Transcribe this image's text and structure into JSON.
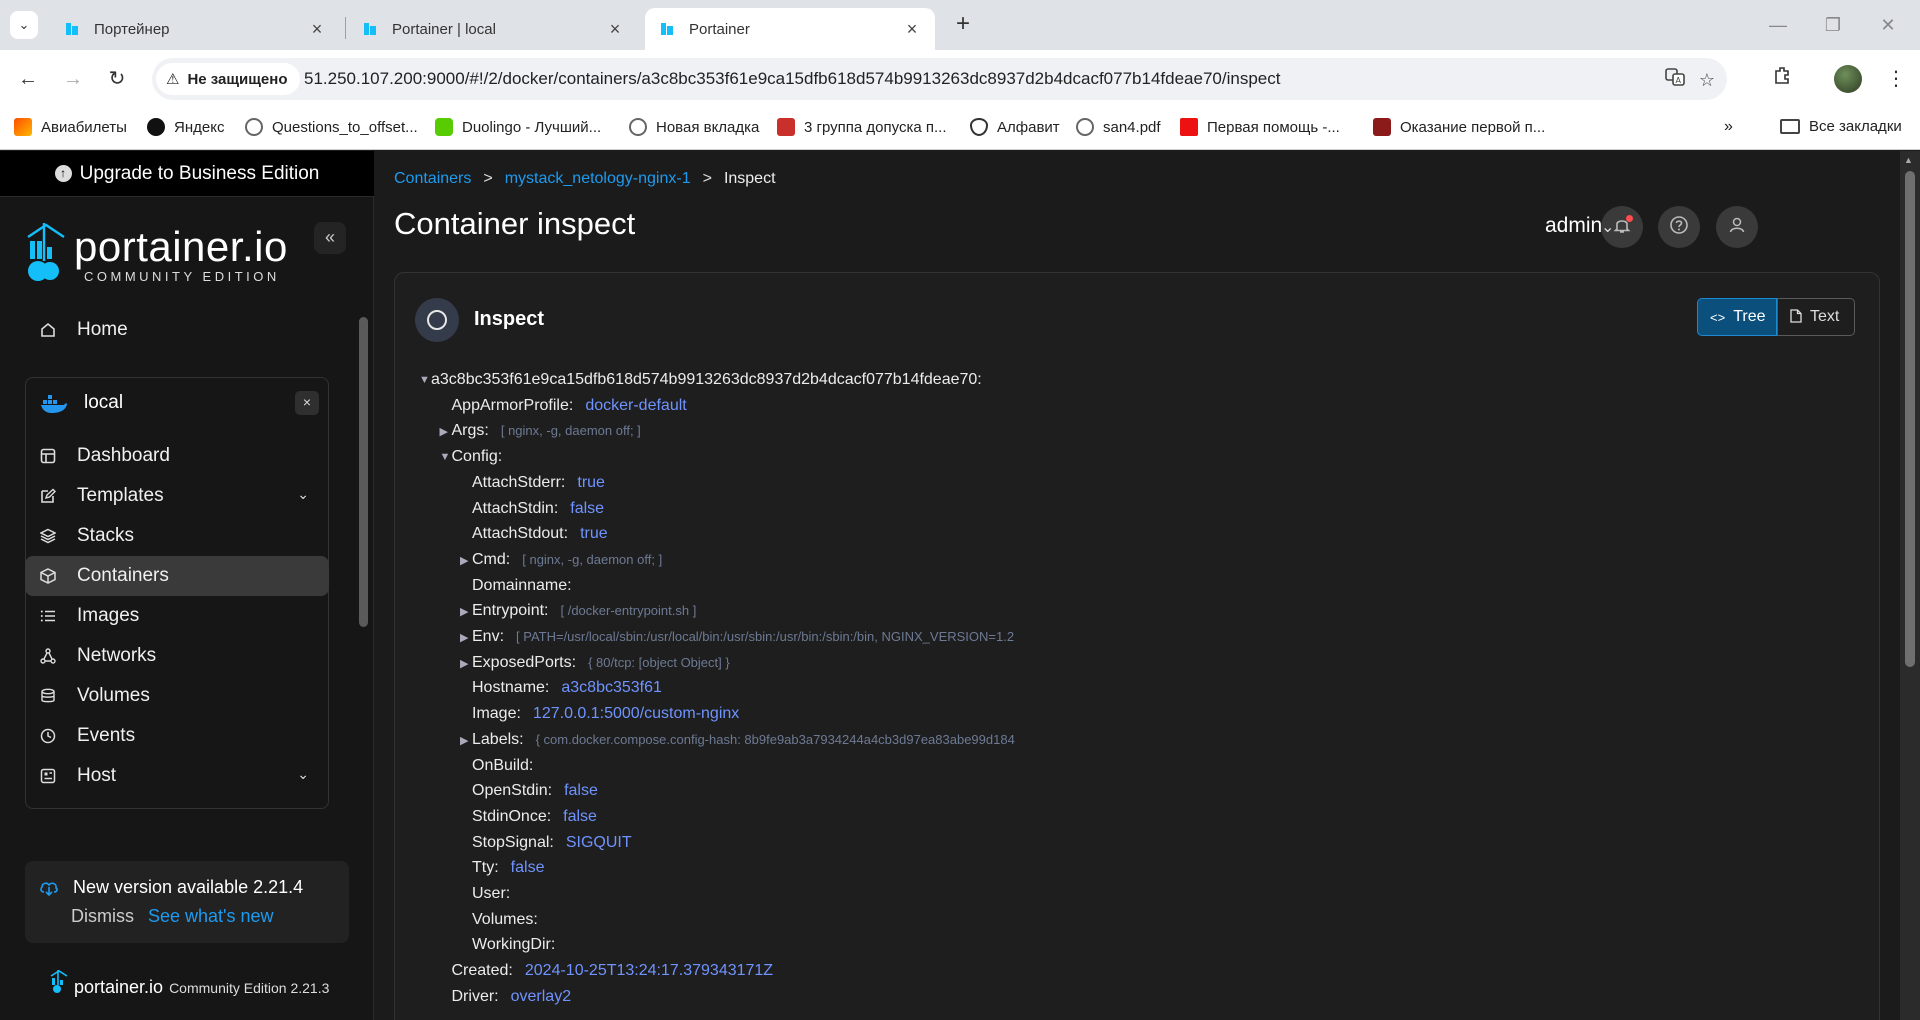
{
  "browser": {
    "tabs": [
      {
        "title": "Портейнер"
      },
      {
        "title": "Portainer | local"
      },
      {
        "title": "Portainer"
      }
    ],
    "security_label": "Не защищено",
    "url": "51.250.107.200:9000/#!/2/docker/containers/a3c8bc353f61e9ca15dfb618d574b9913263dc8937d2b4dcacf077b14fdeae70/inspect",
    "bookmarks": [
      "Авиабилеты",
      "Яндекс",
      "Questions_to_offset...",
      "Duolingo - Лучший...",
      "Новая вкладка",
      "3 группа допуска п...",
      "Алфавит",
      "san4.pdf",
      "Первая помощь -...",
      "Оказание первой п..."
    ],
    "all_bookmarks": "Все закладки"
  },
  "sidebar": {
    "upgrade": "Upgrade to Business Edition",
    "logo_word": "portainer.io",
    "logo_sub": "COMMUNITY EDITION",
    "home": "Home",
    "env_name": "local",
    "items": [
      "Dashboard",
      "Templates",
      "Stacks",
      "Containers",
      "Images",
      "Networks",
      "Volumes",
      "Events",
      "Host"
    ],
    "update_title": "New version available 2.21.4",
    "dismiss": "Dismiss",
    "whats_new": "See what's new",
    "footer_name": "portainer.io",
    "footer_version": "Community Edition 2.21.3"
  },
  "main": {
    "breadcrumb": [
      "Containers",
      "mystack_netology-nginx-1",
      "Inspect"
    ],
    "title": "Container inspect",
    "user": "admin",
    "widget_title": "Inspect",
    "view_tree": "Tree",
    "view_text": "Text"
  },
  "tree": [
    {
      "key": "a3c8bc353f61e9ca15dfb618d574b9913263dc8937d2b4dcacf077b14fdeae70:",
      "value": "",
      "preview": "",
      "depth": 0,
      "toggle": "open"
    },
    {
      "key": "AppArmorProfile:",
      "value": "docker-default",
      "preview": "",
      "depth": 1,
      "toggle": ""
    },
    {
      "key": "Args:",
      "value": "",
      "preview": "[ nginx, -g, daemon off; ]",
      "depth": 1,
      "toggle": "closed"
    },
    {
      "key": "Config:",
      "value": "",
      "preview": "",
      "depth": 1,
      "toggle": "open"
    },
    {
      "key": "AttachStderr:",
      "value": "true",
      "preview": "",
      "depth": 2,
      "toggle": ""
    },
    {
      "key": "AttachStdin:",
      "value": "false",
      "preview": "",
      "depth": 2,
      "toggle": ""
    },
    {
      "key": "AttachStdout:",
      "value": "true",
      "preview": "",
      "depth": 2,
      "toggle": ""
    },
    {
      "key": "Cmd:",
      "value": "",
      "preview": "[ nginx, -g, daemon off; ]",
      "depth": 2,
      "toggle": "closed"
    },
    {
      "key": "Domainname:",
      "value": "",
      "preview": "",
      "depth": 2,
      "toggle": ""
    },
    {
      "key": "Entrypoint:",
      "value": "",
      "preview": "[ /docker-entrypoint.sh ]",
      "depth": 2,
      "toggle": "closed"
    },
    {
      "key": "Env:",
      "value": "",
      "preview": "[ PATH=/usr/local/sbin:/usr/local/bin:/usr/sbin:/usr/bin:/sbin:/bin, NGINX_VERSION=1.2",
      "depth": 2,
      "toggle": "closed"
    },
    {
      "key": "ExposedPorts:",
      "value": "",
      "preview": "{ 80/tcp: [object Object] }",
      "depth": 2,
      "toggle": "closed"
    },
    {
      "key": "Hostname:",
      "value": "a3c8bc353f61",
      "preview": "",
      "depth": 2,
      "toggle": ""
    },
    {
      "key": "Image:",
      "value": "127.0.0.1:5000/custom-nginx",
      "preview": "",
      "depth": 2,
      "toggle": ""
    },
    {
      "key": "Labels:",
      "value": "",
      "preview": "{ com.docker.compose.config-hash: 8b9fe9ab3a7934244a4cb3d97ea83abe99d184",
      "depth": 2,
      "toggle": "closed"
    },
    {
      "key": "OnBuild:",
      "value": "",
      "preview": "",
      "depth": 2,
      "toggle": ""
    },
    {
      "key": "OpenStdin:",
      "value": "false",
      "preview": "",
      "depth": 2,
      "toggle": ""
    },
    {
      "key": "StdinOnce:",
      "value": "false",
      "preview": "",
      "depth": 2,
      "toggle": ""
    },
    {
      "key": "StopSignal:",
      "value": "SIGQUIT",
      "preview": "",
      "depth": 2,
      "toggle": ""
    },
    {
      "key": "Tty:",
      "value": "false",
      "preview": "",
      "depth": 2,
      "toggle": ""
    },
    {
      "key": "User:",
      "value": "",
      "preview": "",
      "depth": 2,
      "toggle": ""
    },
    {
      "key": "Volumes:",
      "value": "",
      "preview": "",
      "depth": 2,
      "toggle": ""
    },
    {
      "key": "WorkingDir:",
      "value": "",
      "preview": "",
      "depth": 2,
      "toggle": ""
    },
    {
      "key": "Created:",
      "value": "2024-10-25T13:24:17.379343171Z",
      "preview": "",
      "depth": 1,
      "toggle": ""
    },
    {
      "key": "Driver:",
      "value": "overlay2",
      "preview": "",
      "depth": 1,
      "toggle": ""
    }
  ],
  "colors": {
    "accent": "#1d9bf0",
    "value_blue": "#6f93ff",
    "preview_gray": "#6d7a94",
    "tree_active_bg": "#0b4f7d"
  }
}
